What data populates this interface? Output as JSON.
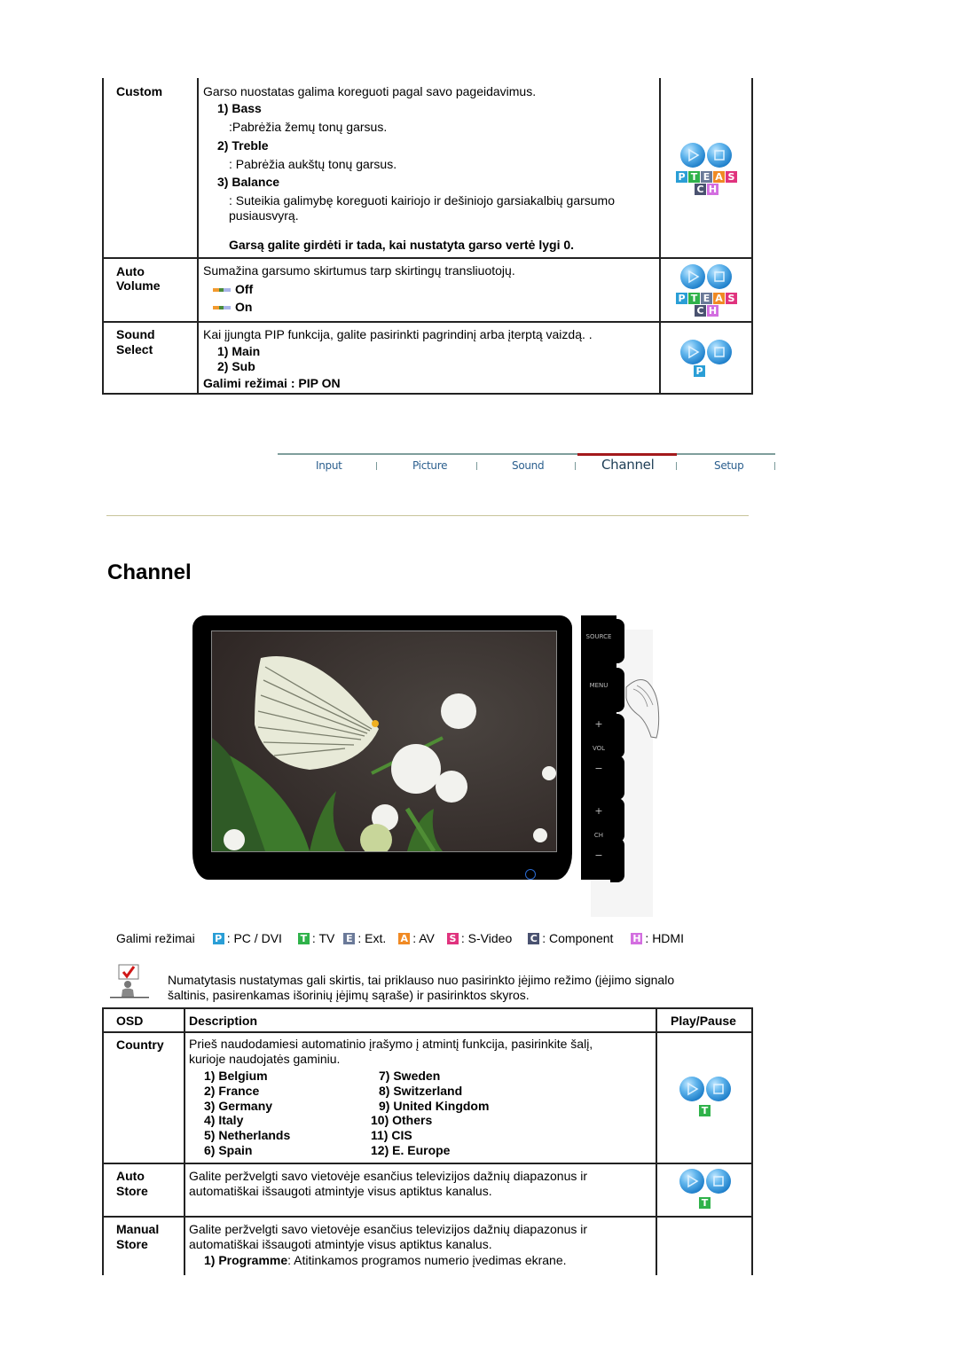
{
  "sound_table": {
    "rows": [
      {
        "osd": "Custom",
        "intro": "Garso nuostatas galima koreguoti pagal savo pageidavimus.",
        "items": [
          {
            "label": "1) Bass",
            "desc": ":Pabrėžia žemų tonų garsus."
          },
          {
            "label": "2) Treble",
            "desc": ": Pabrėžia aukštų tonų garsus."
          },
          {
            "label": "3) Balance",
            "desc": ": Suteikia galimybę koreguoti kairiojo ir dešiniojo garsiakalbių garsumo",
            "desc2": "pusiausvyrą."
          }
        ],
        "note": "Garsą galite girdėti ir tada, kai nustatyta garso vertė lygi 0.",
        "badges": [
          "P",
          "T",
          "E",
          "A",
          "S",
          "C",
          "H"
        ]
      },
      {
        "osd_line1": "Auto",
        "osd_line2": "Volume",
        "intro": "Sumažina garsumo skirtumus tarp skirtingų transliuotojų.",
        "options": [
          "Off",
          "On"
        ],
        "badges": [
          "P",
          "T",
          "E",
          "A",
          "S",
          "C",
          "H"
        ]
      },
      {
        "osd_line1": "Sound",
        "osd_line2": "Select",
        "intro": "Kai įjungta PIP funkcija, galite pasirinkti pagrindinį arba įterptą vaizdą. .",
        "options": [
          "1) Main",
          "2) Sub"
        ],
        "note": "Galimi režimai : PIP ON",
        "badges": [
          "P"
        ]
      }
    ]
  },
  "tabs": [
    {
      "label": "Input",
      "active": false
    },
    {
      "label": "Picture",
      "active": false
    },
    {
      "label": "Sound",
      "active": false
    },
    {
      "label": "Channel",
      "active": true
    },
    {
      "label": "Setup",
      "active": false
    }
  ],
  "section_title": "Channel",
  "monitor": {
    "side_buttons": [
      "SOURCE",
      "MENU",
      "+",
      "VOL",
      "−",
      "+",
      "CH",
      "−"
    ]
  },
  "modes": {
    "label": "Galimi režimai",
    "items": [
      {
        "badge": "P",
        "text": ": PC / DVI",
        "color": "#2a9ed6"
      },
      {
        "badge": "T",
        "text": ": TV",
        "color": "#2fb24a"
      },
      {
        "badge": "E",
        "text": ": Ext.",
        "color": "#6b7a99"
      },
      {
        "badge": "A",
        "text": ": AV",
        "color": "#f08a24"
      },
      {
        "badge": "S",
        "text": ": S-Video",
        "color": "#e0337e"
      },
      {
        "badge": "C",
        "text": ": Component",
        "color": "#4a5270"
      },
      {
        "badge": "H",
        "text": ": HDMI",
        "color": "#d36ee0"
      }
    ]
  },
  "note": {
    "line1": "Numatytasis nustatymas gali skirtis, tai priklauso nuo pasirinkto įėjimo režimo (įėjimo signalo",
    "line2": "šaltinis, pasirenkamas išorinių įėjimų sąraše) ir pasirinktos skyros."
  },
  "channel_table": {
    "headers": {
      "osd": "OSD",
      "description": "Description",
      "playpause": "Play/Pause"
    },
    "country": {
      "osd": "Country",
      "intro1": "Prieš naudodamiesi automatinio įrašymo į atmintį funkcija, pasirinkite šalį,",
      "intro2": "kurioje naudojatės gaminiu.",
      "left": [
        "1) Belgium",
        "2) France",
        "3) Germany",
        "4) Italy",
        "5) Netherlands",
        "6) Spain"
      ],
      "right": [
        "7) Sweden",
        "8) Switzerland",
        "9) United Kingdom",
        "10) Others",
        "11) CIS",
        "12) E. Europe"
      ],
      "badge": "T"
    },
    "auto_store": {
      "osd_line1": "Auto",
      "osd_line2": "Store",
      "line1": "Galite peržvelgti savo vietovėje esančius televizijos dažnių diapazonus ir",
      "line2": "automatiškai išsaugoti atmintyje visus aptiktus kanalus.",
      "badge": "T"
    },
    "manual_store": {
      "osd_line1": "Manual",
      "osd_line2": "Store",
      "line1": "Galite peržvelgti savo vietovėje esančius televizijos dažnių diapazonus ir",
      "line2": "automatiškai išsaugoti atmintyje visus aptiktus kanalus.",
      "item_label": "1) Programme",
      "item_desc": ": Atitinkamos programos numerio įvedimas ekrane."
    }
  },
  "badge_colors": {
    "P": "#2a9ed6",
    "T": "#2fb24a",
    "E": "#6b7a99",
    "A": "#f08a24",
    "S": "#e0337e",
    "C": "#4a5270",
    "H": "#d36ee0"
  }
}
